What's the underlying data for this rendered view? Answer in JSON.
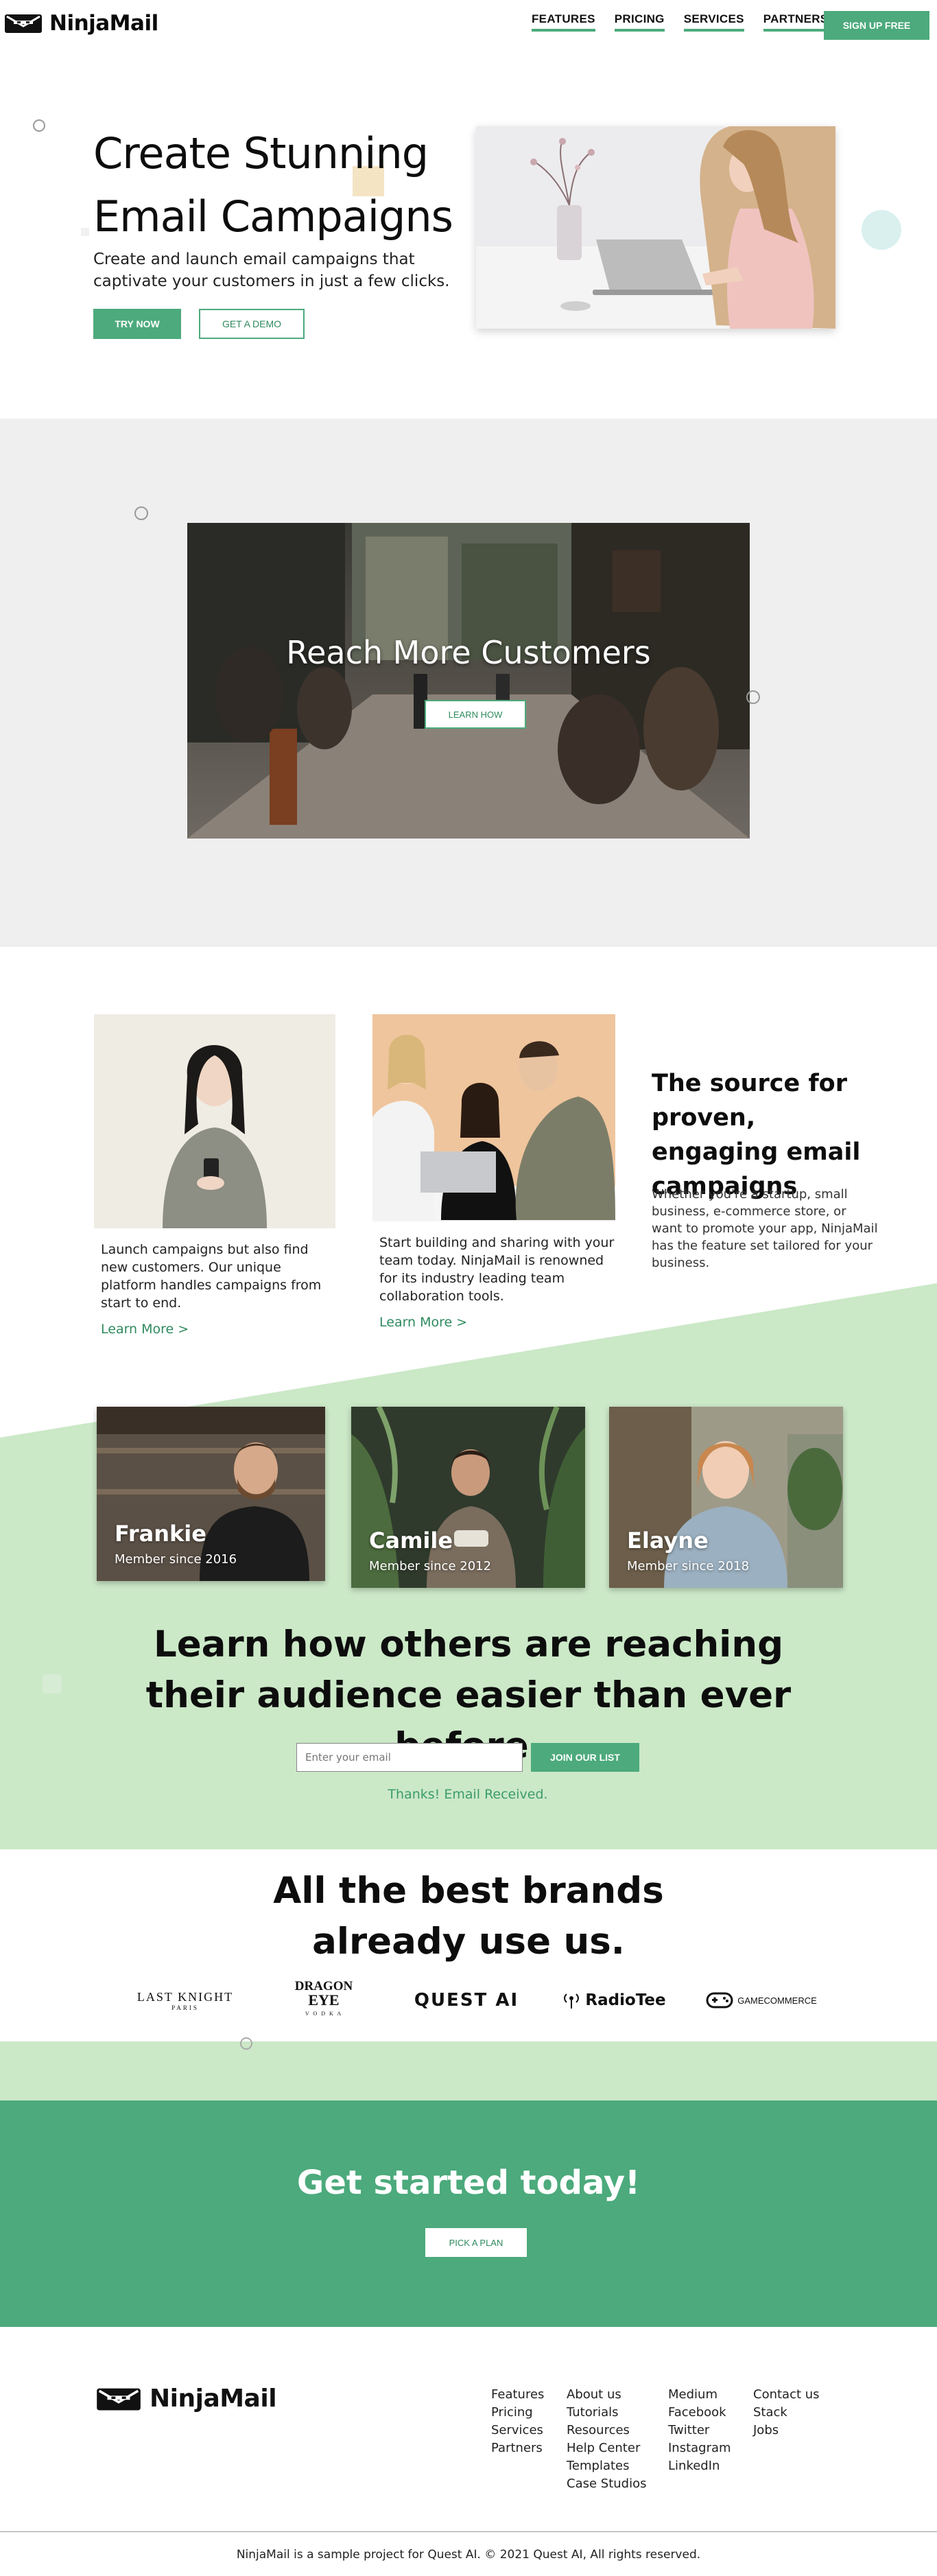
{
  "brand": {
    "name": "NinjaMail",
    "accent": "#4caa7c",
    "light_green": "#cbe8c7",
    "gray_band": "#efefef"
  },
  "nav": {
    "links": [
      "FEATURES",
      "PRICING",
      "SERVICES",
      "PARTNERS"
    ],
    "signup": "SIGN UP FREE"
  },
  "hero": {
    "title": "Create Stunning Email Campaigns",
    "subtitle": "Create and launch email campaigns that captivate your customers in just a few clicks.",
    "try_button": "TRY NOW",
    "demo_button": "GET A DEMO"
  },
  "banner": {
    "title": "Reach More Customers",
    "button": "LEARN HOW"
  },
  "features": {
    "cards": [
      {
        "text": "Launch campaigns but also find new customers. Our unique platform handles campaigns from start to end.",
        "link": "Learn More >"
      },
      {
        "text": "Start building and sharing with your team today. NinjaMail is renowned for its industry leading team collaboration tools.",
        "link": "Learn More >"
      }
    ],
    "title": "The source for proven, engaging email campaigns",
    "body": "Whether you're a startup, small business, e-commerce store, or want to promote your app, NinjaMail has the feature set tailored for your business."
  },
  "members": [
    {
      "name": "Frankie",
      "since": "Member since 2016"
    },
    {
      "name": "Camile",
      "since": "Member since 2012"
    },
    {
      "name": "Elayne",
      "since": "Member since 2018"
    }
  ],
  "signup_section": {
    "title": "Learn how others are reaching their audience easier than ever before.",
    "email_placeholder": "Enter your email",
    "join_button": "JOIN OUR LIST",
    "thanks": "Thanks! Email Received."
  },
  "brands": {
    "title": "All the best brands already use us.",
    "logos": [
      "LAST KNIGHT",
      "PARIS",
      "DRAGON",
      "EYE",
      "V O D K A",
      "QUEST AI",
      "RadioTee",
      "GAMECOMMERCE"
    ]
  },
  "cta": {
    "title": "Get started today!",
    "button": "PICK A PLAN"
  },
  "footer": {
    "columns": [
      [
        "Features",
        "Pricing",
        "Services",
        "Partners"
      ],
      [
        "About us",
        "Tutorials",
        "Resources",
        "Help Center",
        "Templates",
        "Case Studios"
      ],
      [
        "Medium",
        "Facebook",
        "Twitter",
        "Instagram",
        "LinkedIn"
      ],
      [
        "Contact us",
        "Stack",
        "Jobs"
      ]
    ],
    "copyright": "NinjaMail is a sample project for Quest AI. © 2021 Quest AI, All rights reserved."
  }
}
